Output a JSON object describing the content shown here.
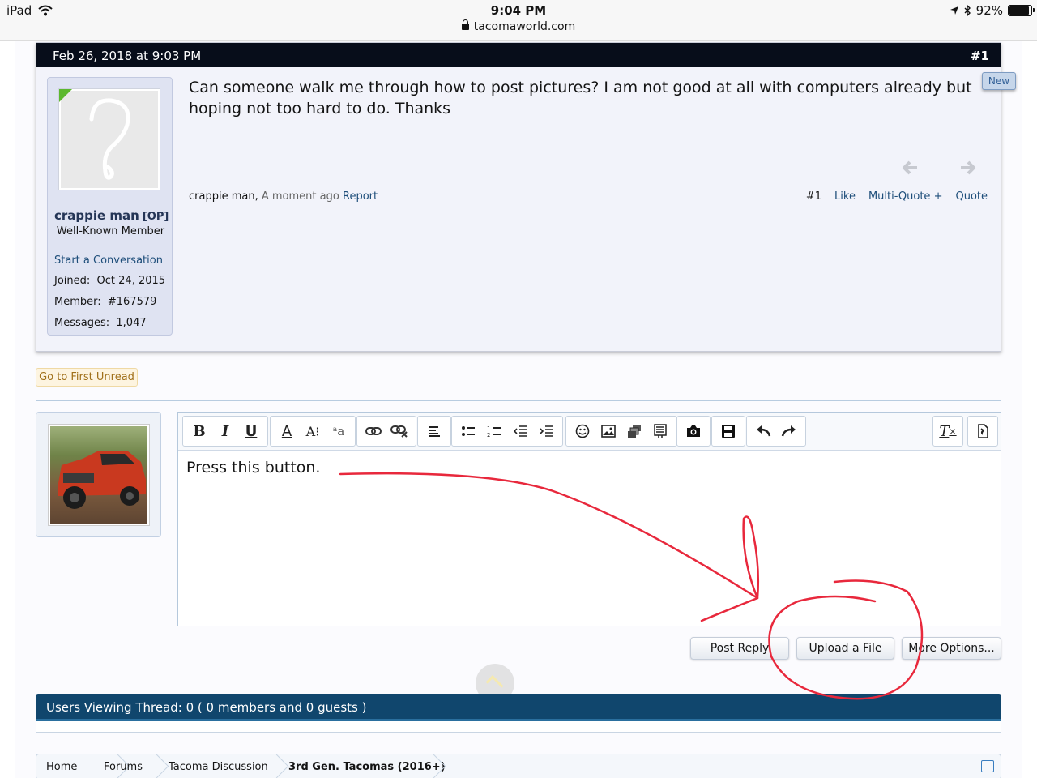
{
  "status_bar": {
    "device": "iPad",
    "time": "9:04 PM",
    "url": "tacomaworld.com",
    "battery": "92%",
    "battery_level": 0.92
  },
  "post": {
    "date": "Feb 26, 2018 at 9:03 PM",
    "number": "#1",
    "new_label": "New",
    "text": "Can someone walk me through how to post pictures? I am not good at all with computers already but hoping not too hard to do. Thanks",
    "author": {
      "name": "crappie man",
      "op_tag": "[OP]",
      "title": "Well-Known Member",
      "start_conversation": "Start a Conversation",
      "joined_label": "Joined:",
      "joined_value": "Oct 24, 2015",
      "member_label": "Member:",
      "member_value": "#167579",
      "messages_label": "Messages:",
      "messages_value": "1,047"
    },
    "footer": {
      "author": "crappie man,",
      "time": "A moment ago",
      "report": "Report",
      "post_num": "#1",
      "like": "Like",
      "multi_quote": "Multi-Quote +",
      "quote": "Quote"
    }
  },
  "go_first_unread": "Go to First Unread",
  "editor": {
    "content": "Press this button.",
    "toolbar_icons": [
      "bold-icon",
      "italic-icon",
      "underline-icon",
      "text-color-icon",
      "font-size-icon",
      "font-family-icon",
      "link-icon",
      "unlink-icon",
      "align-icon",
      "bullet-list-icon",
      "numbered-list-icon",
      "outdent-icon",
      "indent-icon",
      "smilie-icon",
      "image-icon",
      "media-icon",
      "code-icon",
      "camera-icon",
      "save-draft-icon",
      "undo-icon",
      "redo-icon",
      "remove-format-icon",
      "toggle-source-icon"
    ]
  },
  "buttons": {
    "post_reply": "Post Reply",
    "upload_file": "Upload a File",
    "more_options": "More Options..."
  },
  "viewing": "Users Viewing Thread: 0 ( 0 members and 0 guests )",
  "breadcrumb": [
    "Home",
    "Forums",
    "Tacoma Discussion",
    "3rd Gen. Tacomas (2016+)"
  ],
  "colors": {
    "header_bg": "#070d1a",
    "link": "#1e4e7a",
    "viewing_bar": "#10466d",
    "annotation": "#e8283c"
  }
}
